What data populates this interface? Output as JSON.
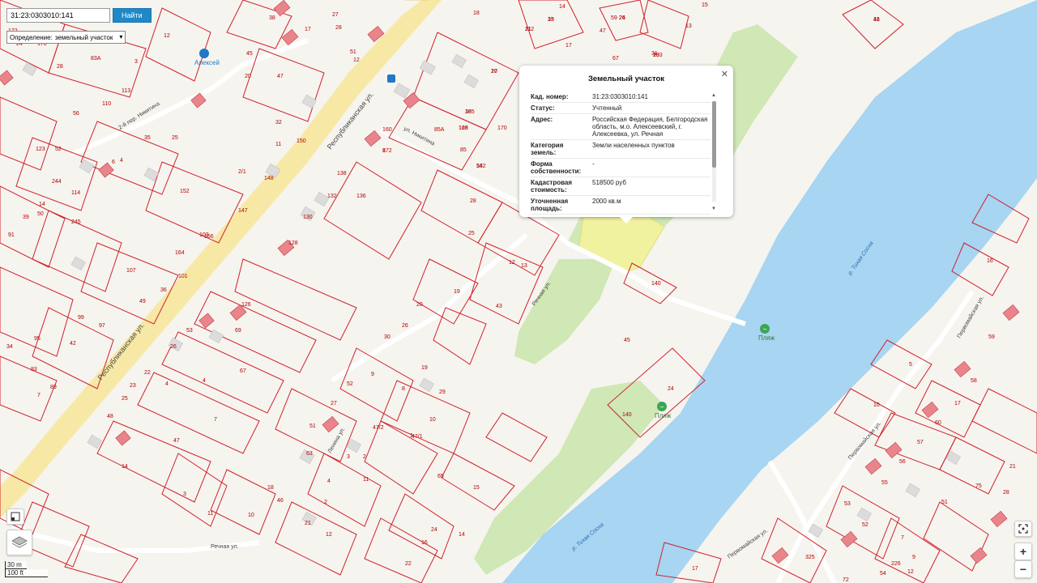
{
  "search": {
    "value": "31:23:0303010:141",
    "button": "Найти"
  },
  "definition": {
    "label": "Определение:",
    "selected": "земельный участок"
  },
  "popup": {
    "title": "Земельный участок",
    "rows": [
      {
        "key": "Кад. номер:",
        "value": "31:23:0303010:141"
      },
      {
        "key": "Статус:",
        "value": "Учтенный"
      },
      {
        "key": "Адрес:",
        "value": "Российская Федерация, Белгородская область, м.о. Алексеевский, г. Алексеевка, ул. Речная"
      },
      {
        "key": "Категория земель:",
        "value": "Земли населенных пунктов"
      },
      {
        "key": "Форма собственности:",
        "value": "-"
      },
      {
        "key": "Кадастровая стоимость:",
        "value": "518500 руб"
      },
      {
        "key": "Уточненная площадь:",
        "value": "2000 кв.м"
      }
    ]
  },
  "streets": {
    "respublikanskaya": "Республиканская ул.",
    "nikitina": "ул. Никитина",
    "nikitina_2": "2-й пер. Никитина",
    "rechnaya": "Речная ул.",
    "lenina": "Ленина ул.",
    "pervomayskaya": "Первомайская ул."
  },
  "river": {
    "name": "р. Тихая Сосна"
  },
  "pois": {
    "beach": "Пляж",
    "alexey": "Алексей"
  },
  "parcel_labels": [
    "18",
    "15",
    "24",
    "23",
    "21",
    "17",
    "165",
    "166",
    "162",
    "170",
    "172",
    "160",
    "85",
    "85A",
    "59",
    "47",
    "67",
    "31",
    "13",
    "15",
    "14",
    "17",
    "12",
    "28",
    "25",
    "19",
    "13",
    "20",
    "26",
    "43",
    "45",
    "24",
    "140",
    "140",
    "15",
    "16",
    "5",
    "10",
    "17",
    "58",
    "59",
    "60",
    "57",
    "56",
    "55",
    "54",
    "53",
    "52",
    "51",
    "7",
    "9",
    "12",
    "21",
    "75",
    "28",
    "72",
    "226",
    "325",
    "17",
    "24",
    "16",
    "14",
    "22",
    "11",
    "21",
    "12",
    "7",
    "1",
    "2",
    "4",
    "3",
    "63",
    "51",
    "27",
    "52",
    "9",
    "30",
    "29",
    "10",
    "47/1",
    "47/2",
    "8",
    "19",
    "2",
    "65",
    "69",
    "67",
    "4",
    "4",
    "7",
    "47",
    "14",
    "3",
    "11",
    "10",
    "18",
    "46",
    "48",
    "25",
    "23",
    "22",
    "26",
    "53",
    "126",
    "128",
    "130",
    "132",
    "136",
    "138",
    "147",
    "148",
    "150",
    "152",
    "164",
    "166",
    "101",
    "103",
    "107",
    "49",
    "36",
    "97",
    "99",
    "42",
    "83",
    "89",
    "95",
    "34",
    "91",
    "50",
    "14",
    "39",
    "114",
    "245",
    "244",
    "123",
    "52",
    "6",
    "4",
    "35",
    "25",
    "32",
    "47",
    "20",
    "11",
    "12",
    "45",
    "24",
    "38",
    "51",
    "12",
    "27",
    "18",
    "8",
    "28",
    "17",
    "56",
    "110",
    "113",
    "3",
    "83A",
    "170",
    "172",
    "28",
    "2/1",
    "41",
    "33",
    "26",
    "103",
    "112",
    "20",
    "38",
    "123",
    "54"
  ],
  "controls": {
    "scale_top": "30 m",
    "scale_bottom": "100 ft",
    "zoom_in": "+",
    "zoom_out": "−"
  }
}
